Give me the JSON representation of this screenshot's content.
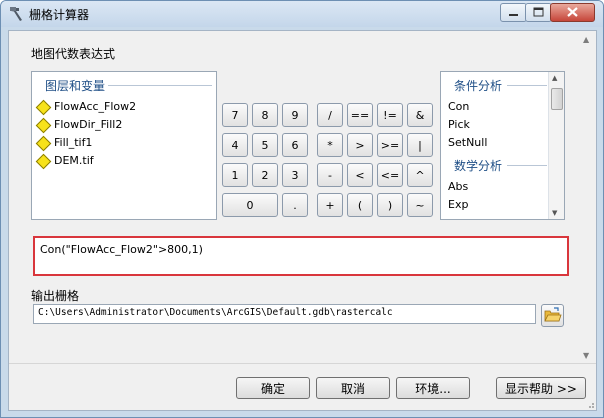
{
  "window": {
    "title": "栅格计算器",
    "icon": "hammer-icon"
  },
  "caption_buttons": {
    "minimize": "minimize-icon",
    "maximize": "maximize-icon",
    "close": "close-icon"
  },
  "map_algebra": {
    "label": "地图代数表达式",
    "layers": {
      "title": "图层和变量",
      "items": [
        "FlowAcc_Flow2",
        "FlowDir_Fill2",
        "Fill_tif1",
        "DEM.tif"
      ]
    },
    "keypad": {
      "rows": [
        [
          "7",
          "8",
          "9",
          "/",
          "==",
          "!=",
          "&"
        ],
        [
          "4",
          "5",
          "6",
          "*",
          ">",
          ">=",
          "|"
        ],
        [
          "1",
          "2",
          "3",
          "-",
          "<",
          "<=",
          "^"
        ],
        [
          "0",
          ".",
          "+",
          "(",
          ")",
          "~"
        ]
      ]
    },
    "functions": {
      "conditional_title": "条件分析",
      "conditional": [
        "Con",
        "Pick",
        "SetNull"
      ],
      "math_title": "数学分析",
      "math": [
        "Abs",
        "Exp"
      ]
    },
    "expression": "Con(\"FlowAcc_Flow2\">800,1)"
  },
  "output": {
    "label": "输出栅格",
    "value": "C:\\Users\\Administrator\\Documents\\ArcGIS\\Default.gdb\\rastercalc",
    "browse_icon": "folder-open-icon"
  },
  "buttons": {
    "ok": "确定",
    "cancel": "取消",
    "environments": "环境...",
    "help": "显示帮助 >>"
  },
  "colors": {
    "highlight_border": "#d9363c",
    "section_title": "#1e4e86",
    "layer_icon": "#f7e21b"
  }
}
